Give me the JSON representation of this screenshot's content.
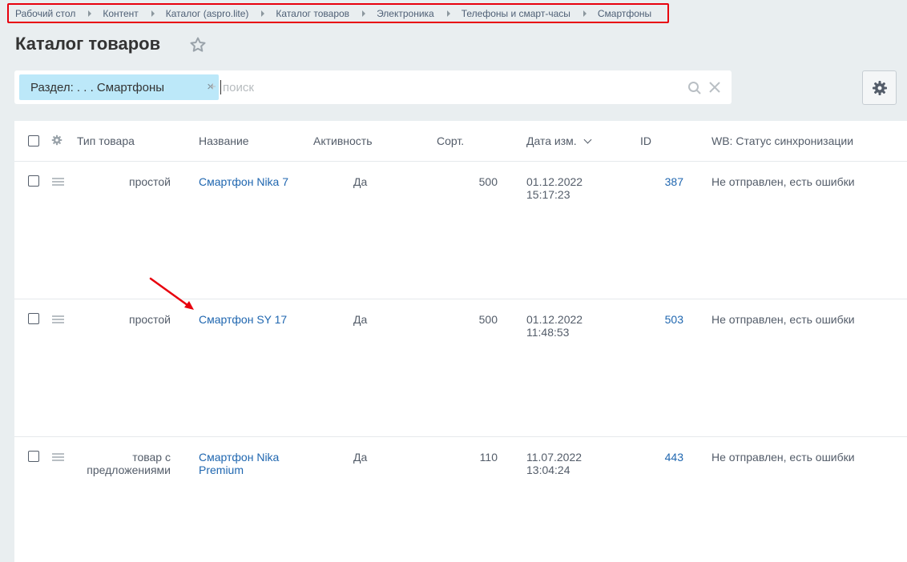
{
  "breadcrumb": [
    "Рабочий стол",
    "Контент",
    "Каталог (aspro.lite)",
    "Каталог товаров",
    "Электроника",
    "Телефоны и смарт-часы",
    "Смартфоны"
  ],
  "page_title": "Каталог товаров",
  "filter": {
    "chip_label": "Раздел: . . . Смартфоны",
    "chip_remove": "×",
    "add_label": "+",
    "search_placeholder": "поиск"
  },
  "table": {
    "columns": {
      "type": "Тип товара",
      "name": "Название",
      "active": "Активность",
      "sort": "Сорт.",
      "date": "Дата изм.",
      "id": "ID",
      "status": "WB: Статус синхронизации"
    },
    "rows": [
      {
        "type": "простой",
        "name": "Смартфон Nika 7",
        "active": "Да",
        "sort": "500",
        "date": "01.12.2022",
        "time": "15:17:23",
        "id": "387",
        "status": "Не отправлен, есть ошибки"
      },
      {
        "type": "простой",
        "name": "Смартфон SY 17",
        "active": "Да",
        "sort": "500",
        "date": "01.12.2022",
        "time": "11:48:53",
        "id": "503",
        "status": "Не отправлен, есть ошибки"
      },
      {
        "type": "товар с предложениями",
        "name": "Смартфон Nika Premium",
        "active": "Да",
        "sort": "110",
        "date": "11.07.2022",
        "time": "13:04:24",
        "id": "443",
        "status": "Не отправлен, есть ошибки"
      }
    ]
  },
  "colors": {
    "highlight": "#e8000d",
    "link": "#2067b0",
    "chip": "#bce8f9"
  }
}
